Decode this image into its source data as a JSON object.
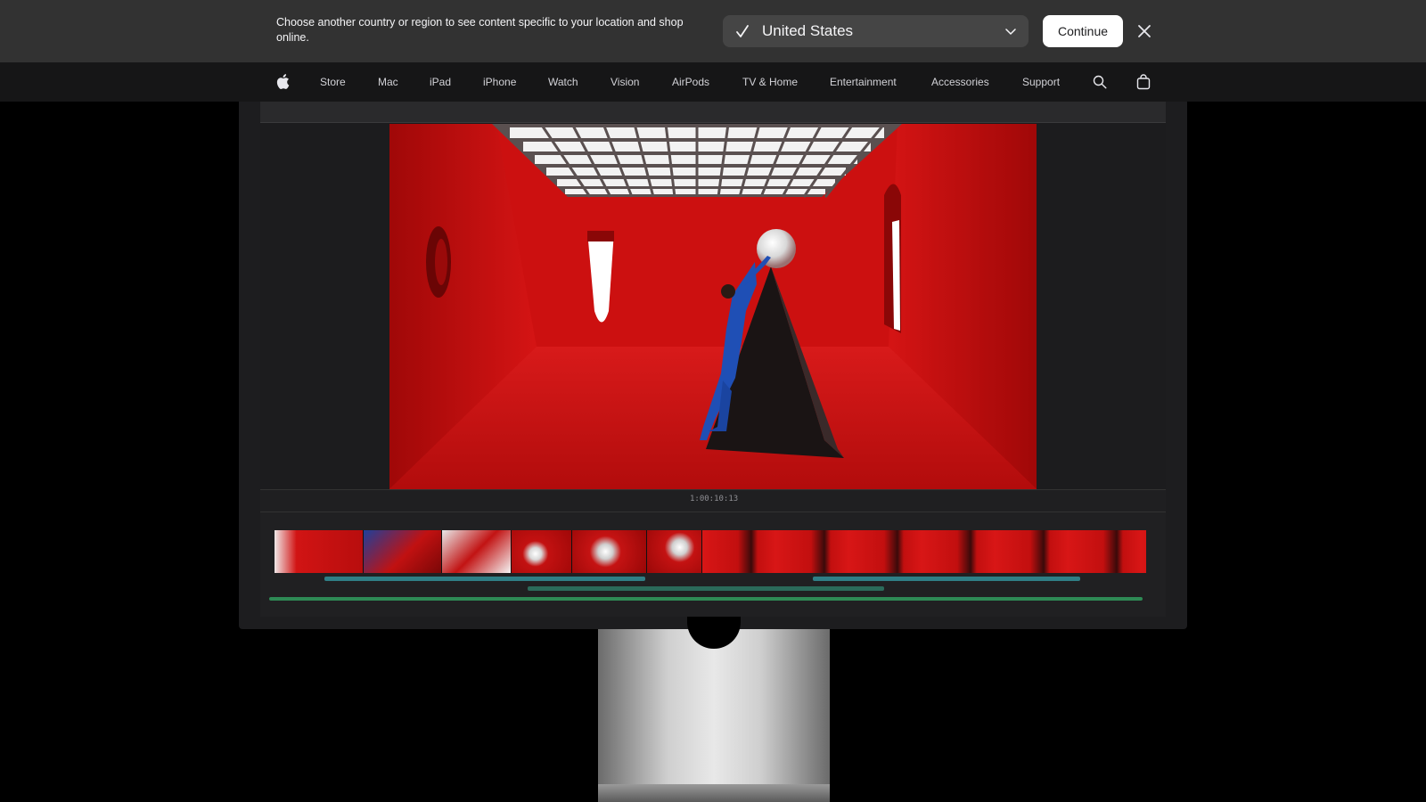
{
  "region_banner": {
    "message": "Choose another country or region to see content specific to your location and shop online.",
    "selected_region": "United States",
    "continue_label": "Continue",
    "close_icon": "close-icon",
    "check_icon": "checkmark-icon",
    "chevron_icon": "chevron-down-icon"
  },
  "nav": {
    "logo_icon": "apple-logo-icon",
    "items": [
      "Store",
      "Mac",
      "iPad",
      "iPhone",
      "Watch",
      "Vision",
      "AirPods",
      "TV & Home",
      "Entertainment",
      "Accessories",
      "Support"
    ],
    "search_icon": "search-icon",
    "bag_icon": "shopping-bag-icon"
  },
  "hero": {
    "screen_app": "video-editor",
    "timecode": "1:00:10:13"
  },
  "colors": {
    "banner_bg": "#323232",
    "nav_bg": "#161617",
    "page_bg": "#000000",
    "scene_red": "#c90f0f",
    "audio_track": "#2f7f86"
  }
}
